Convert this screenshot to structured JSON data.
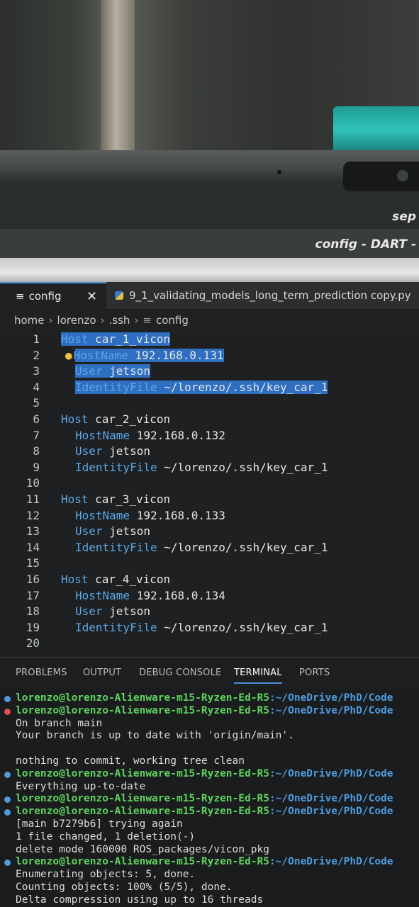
{
  "topbar": {
    "clock": "sep"
  },
  "window": {
    "title": "config - DART -"
  },
  "tabs": [
    {
      "label": "config",
      "close": "✕"
    },
    {
      "label": "9_1_validating_models_long_term_prediction copy.py"
    }
  ],
  "breadcrumb": [
    "home",
    "lorenzo",
    ".ssh",
    "config"
  ],
  "editor": {
    "lines": [
      {
        "num": "1",
        "kw": "Host",
        "val": " car_1_vicon",
        "indent": 0,
        "sel": true
      },
      {
        "num": "2",
        "kw": "HostName",
        "val": " 192.168.0.131",
        "indent": 1,
        "sel": true,
        "bulb": true
      },
      {
        "num": "3",
        "kw": "User",
        "val": " jetson",
        "indent": 1,
        "sel": true
      },
      {
        "num": "4",
        "kw": "IdentityFile",
        "val": " ~/lorenzo/.ssh/key_car_1",
        "indent": 1,
        "sel": true
      },
      {
        "num": "5",
        "kw": "",
        "val": "",
        "indent": 0
      },
      {
        "num": "6",
        "kw": "Host",
        "val": " car_2_vicon",
        "indent": 0
      },
      {
        "num": "7",
        "kw": "HostName",
        "val": " 192.168.0.132",
        "indent": 1
      },
      {
        "num": "8",
        "kw": "User",
        "val": " jetson",
        "indent": 1
      },
      {
        "num": "9",
        "kw": "IdentityFile",
        "val": " ~/lorenzo/.ssh/key_car_1",
        "indent": 1
      },
      {
        "num": "10",
        "kw": "",
        "val": "",
        "indent": 0
      },
      {
        "num": "11",
        "kw": "Host",
        "val": " car_3_vicon",
        "indent": 0
      },
      {
        "num": "12",
        "kw": "HostName",
        "val": " 192.168.0.133",
        "indent": 1
      },
      {
        "num": "13",
        "kw": "User",
        "val": " jetson",
        "indent": 1
      },
      {
        "num": "14",
        "kw": "IdentityFile",
        "val": " ~/lorenzo/.ssh/key_car_1",
        "indent": 1
      },
      {
        "num": "15",
        "kw": "",
        "val": "",
        "indent": 0
      },
      {
        "num": "16",
        "kw": "Host",
        "val": " car_4_vicon",
        "indent": 0
      },
      {
        "num": "17",
        "kw": "HostName",
        "val": " 192.168.0.134",
        "indent": 1
      },
      {
        "num": "18",
        "kw": "User",
        "val": " jetson",
        "indent": 1
      },
      {
        "num": "19",
        "kw": "IdentityFile",
        "val": " ~/lorenzo/.ssh/key_car_1",
        "indent": 1
      },
      {
        "num": "20",
        "kw": "",
        "val": "",
        "indent": 0
      }
    ]
  },
  "panel": {
    "tabs": [
      "PROBLEMS",
      "OUTPUT",
      "DEBUG CONSOLE",
      "TERMINAL",
      "PORTS"
    ],
    "active": "TERMINAL"
  },
  "terminal": {
    "user_host": "lorenzo@lorenzo-Alienware-m15-Ryzen-Ed-R5",
    "path": ":~/OneDrive/PhD/Code",
    "lines": [
      {
        "type": "prompt",
        "dot": "ok"
      },
      {
        "type": "prompt",
        "dot": "err"
      },
      {
        "type": "text",
        "text": "On branch main"
      },
      {
        "type": "text",
        "text": "Your branch is up to date with 'origin/main'."
      },
      {
        "type": "text",
        "text": ""
      },
      {
        "type": "text",
        "text": "nothing to commit, working tree clean"
      },
      {
        "type": "prompt",
        "dot": "ok"
      },
      {
        "type": "text",
        "text": "Everything up-to-date"
      },
      {
        "type": "prompt",
        "dot": "ok"
      },
      {
        "type": "prompt",
        "dot": "ok"
      },
      {
        "type": "text",
        "text": "[main b7279b6] trying again"
      },
      {
        "type": "text",
        "text": " 1 file changed, 1 deletion(-)"
      },
      {
        "type": "text",
        "text": " delete mode 160000 ROS_packages/vicon_pkg"
      },
      {
        "type": "prompt",
        "dot": "ok"
      },
      {
        "type": "text",
        "text": "Enumerating objects: 5, done."
      },
      {
        "type": "text",
        "text": "Counting objects: 100% (5/5), done."
      },
      {
        "type": "text",
        "text": "Delta compression using up to 16 threads"
      }
    ]
  }
}
